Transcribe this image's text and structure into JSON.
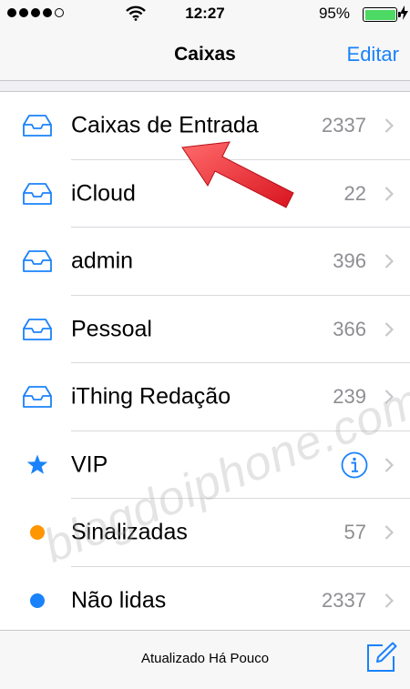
{
  "status_bar": {
    "time": "12:27",
    "battery_percent": "95%",
    "signal_bars": 4
  },
  "nav": {
    "title": "Caixas",
    "edit_label": "Editar"
  },
  "mailboxes": [
    {
      "label": "Caixas de Entrada",
      "count": "2337",
      "icon": "inbox-tray-icon"
    },
    {
      "label": "iCloud",
      "count": "22",
      "icon": "inbox-tray-icon"
    },
    {
      "label": "admin",
      "count": "396",
      "icon": "inbox-tray-icon"
    },
    {
      "label": "Pessoal",
      "count": "366",
      "icon": "inbox-tray-icon"
    },
    {
      "label": "iThing Redação",
      "count": "239",
      "icon": "inbox-tray-icon"
    },
    {
      "label": "VIP",
      "icon": "star-icon",
      "detail_icon": "info-icon"
    },
    {
      "label": "Sinalizadas",
      "count": "57",
      "icon": "orange-dot-icon"
    },
    {
      "label": "Não lidas",
      "count": "2337",
      "icon": "blue-dot-icon"
    }
  ],
  "toolbar": {
    "status_text": "Atualizado Há Pouco",
    "compose_icon": "compose-icon"
  },
  "watermark": "blogdoiphone.com",
  "colors": {
    "accent": "#1a82fb",
    "flagged": "#ff9500",
    "unread": "#1a82fb",
    "battery": "#4cd964",
    "annotation_arrow": "#e8202a"
  }
}
